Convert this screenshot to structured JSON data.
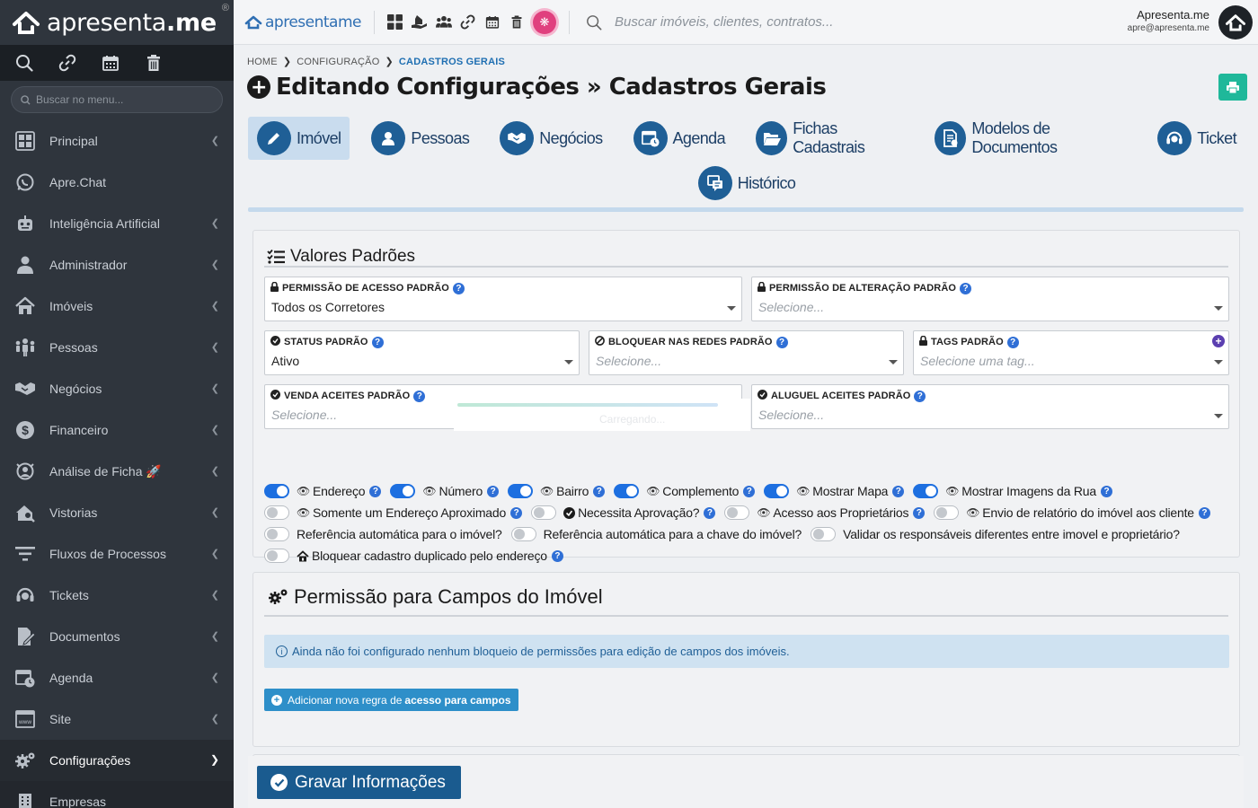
{
  "sidebar": {
    "brand_light": "apresenta",
    "brand_bold": ".me",
    "brand_reg": "®",
    "search_placeholder": "Buscar no menu...",
    "items": [
      {
        "label": "Principal"
      },
      {
        "label": "Apre.Chat"
      },
      {
        "label": "Inteligência Artificial"
      },
      {
        "label": "Administrador"
      },
      {
        "label": "Imóveis"
      },
      {
        "label": "Pessoas"
      },
      {
        "label": "Negócios"
      },
      {
        "label": "Financeiro"
      },
      {
        "label": "Análise de Ficha"
      },
      {
        "label": "Vistorias"
      },
      {
        "label": "Fluxos de Processos"
      },
      {
        "label": "Tickets"
      },
      {
        "label": "Documentos"
      },
      {
        "label": "Agenda"
      },
      {
        "label": "Site"
      },
      {
        "label": "Configurações"
      },
      {
        "label": "Empresas"
      }
    ]
  },
  "topbar": {
    "logo_text": "apresentame",
    "search_placeholder": "Buscar imóveis, clientes, contratos...",
    "user_name": "Apresenta.me",
    "user_email": "apre@apresenta.me"
  },
  "breadcrumb": {
    "home": "HOME",
    "config": "CONFIGURAÇÃO",
    "current": "CADASTROS GERAIS"
  },
  "page": {
    "title_prefix": "Editando",
    "title_bold": "Configurações » Cadastros Gerais"
  },
  "tabs": [
    {
      "label": "Imóvel",
      "active": true
    },
    {
      "label": "Pessoas"
    },
    {
      "label": "Negócios"
    },
    {
      "label": "Agenda"
    },
    {
      "label": "Fichas Cadastrais"
    },
    {
      "label": "Modelos de Documentos"
    },
    {
      "label": "Ticket"
    },
    {
      "label": "Histórico"
    }
  ],
  "defaults": {
    "title": "Valores Padrões",
    "fields": {
      "access_label": "PERMISSÃO DE ACESSO PADRÃO",
      "access_value": "Todos os Corretores",
      "change_label": "PERMISSÃO DE ALTERAÇÃO PADRÃO",
      "change_placeholder": "Selecione...",
      "status_label": "STATUS PADRÃO",
      "status_value": "Ativo",
      "block_label": "BLOQUEAR NAS REDES PADRÃO",
      "block_placeholder": "Selecione...",
      "tags_label": "TAGS PADRÃO",
      "tags_placeholder": "Selecione uma tag...",
      "sale_label": "VENDA ACEITES PADRÃO",
      "sale_placeholder": "Selecione...",
      "rent_label": "ALUGUEL ACEITES PADRÃO",
      "rent_placeholder": "Selecione...",
      "loading_text": "Carregando..."
    },
    "toggles": {
      "endereco": {
        "label": "Endereço",
        "on": true
      },
      "numero": {
        "label": "Número",
        "on": true
      },
      "bairro": {
        "label": "Bairro",
        "on": true
      },
      "complemento": {
        "label": "Complemento",
        "on": true
      },
      "mapa": {
        "label": "Mostrar Mapa",
        "on": true
      },
      "imagens_rua": {
        "label": "Mostrar Imagens da Rua",
        "on": true
      },
      "endereco_aprox": {
        "label": "Somente um Endereço Aproximado",
        "on": false
      },
      "aprovacao": {
        "label": "Necessita Aprovação?",
        "on": false
      },
      "acesso_prop": {
        "label": "Acesso aos Proprietários",
        "on": false
      },
      "relatorio": {
        "label": "Envio de relatório do imóvel aos cliente",
        "on": false
      },
      "ref_imovel": {
        "label": "Referência automática para o imóvel?",
        "on": false
      },
      "ref_chave": {
        "label": "Referência automática para a chave do imóvel?",
        "on": false
      },
      "validar": {
        "label": "Validar os responsáveis diferentes entre imovel e proprietário?",
        "on": false
      },
      "duplicado": {
        "label": "Bloquear cadastro duplicado pelo endereço",
        "on": false
      }
    }
  },
  "permissions": {
    "title": "Permissão para Campos do Imóvel",
    "alert": "Ainda não foi configurado nenhum bloqueio de permissões para edição de campos dos imóveis.",
    "add_prefix": "Adicionar nova regra de",
    "add_bold": "acesso para campos"
  },
  "save": {
    "label": "Gravar Informações"
  },
  "colors": {
    "sidebar_bg": "#2f353d",
    "primary": "#1f5f96",
    "toggle_on": "#1d6fe0",
    "print_button": "#1fb89a",
    "accent_pink": "#e0407e"
  }
}
